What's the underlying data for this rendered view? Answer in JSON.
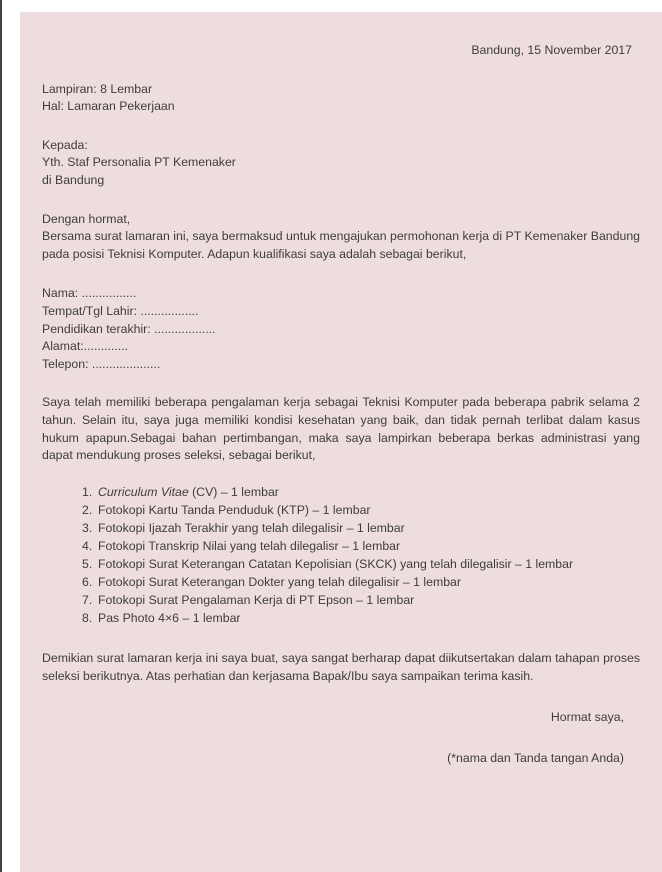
{
  "document": {
    "type": "job-application-letter",
    "page_bg": "#eeddde",
    "text_color": "#3d3d3d",
    "date_line": "Bandung, 15 November 2017",
    "attachment_line": "Lampiran: 8 Lembar",
    "subject_line": "Hal: Lamaran Pekerjaan",
    "recipient": {
      "line1": "Kepada:",
      "line2": "Yth. Staf Personalia PT Kemenaker",
      "line3": "di Bandung"
    },
    "salutation": "Dengan hormat,",
    "intro_paragraph": "Bersama surat lamaran ini, saya bermaksud untuk mengajukan permohonan kerja di PT Kemenaker Bandung pada posisi Teknisi Komputer. Adapun kualifikasi saya adalah sebagai berikut,",
    "personal_fields": [
      "Nama: ................",
      "Tempat/Tgl Lahir: .................",
      "Pendidikan terakhir: ..................",
      "Alamat:.............",
      "Telepon: ...................."
    ],
    "experience_paragraph": "Saya telah memiliki beberapa pengalaman kerja sebagai Teknisi Komputer pada beberapa pabrik selama 2 tahun. Selain itu, saya juga memiliki kondisi kesehatan yang baik, dan tidak pernah terlibat dalam kasus hukum apapun.Sebagai bahan pertimbangan, maka saya lampirkan beberapa berkas administrasi yang dapat mendukung proses seleksi, sebagai berikut,",
    "attachments": [
      {
        "num": "1.",
        "italic_text": "Curriculum Vitae",
        "rest_text": " (CV) – 1 lembar"
      },
      {
        "num": "2.",
        "italic_text": "",
        "rest_text": "Fotokopi Kartu Tanda Penduduk (KTP) – 1 lembar"
      },
      {
        "num": "3.",
        "italic_text": "",
        "rest_text": "Fotokopi Ijazah Terakhir yang telah dilegalisir – 1 lembar"
      },
      {
        "num": "4.",
        "italic_text": "",
        "rest_text": "Fotokopi Transkrip Nilai yang telah dilegalisr – 1 lembar"
      },
      {
        "num": "5.",
        "italic_text": "",
        "rest_text": "Fotokopi Surat Keterangan Catatan Kepolisian (SKCK) yang telah dilegalisir – 1 lembar"
      },
      {
        "num": "6.",
        "italic_text": "",
        "rest_text": "Fotokopi Surat Keterangan Dokter yang telah dilegalisir – 1 lembar"
      },
      {
        "num": "7.",
        "italic_text": "",
        "rest_text": "Fotokopi Surat Pengalaman Kerja di PT Epson – 1 lembar"
      },
      {
        "num": "8.",
        "italic_text": "",
        "rest_text": "Pas Photo 4×6 – 1 lembar"
      }
    ],
    "closing_paragraph": "Demikian surat lamaran kerja ini saya buat, saya sangat berharap dapat diikutsertakan dalam tahapan proses seleksi berikutnya. Atas perhatian dan kerjasama Bapak/Ibu saya sampaikan terima kasih.",
    "signature_closing": "Hormat saya,",
    "signature_name_placeholder": "(*nama dan Tanda tangan Anda)"
  }
}
